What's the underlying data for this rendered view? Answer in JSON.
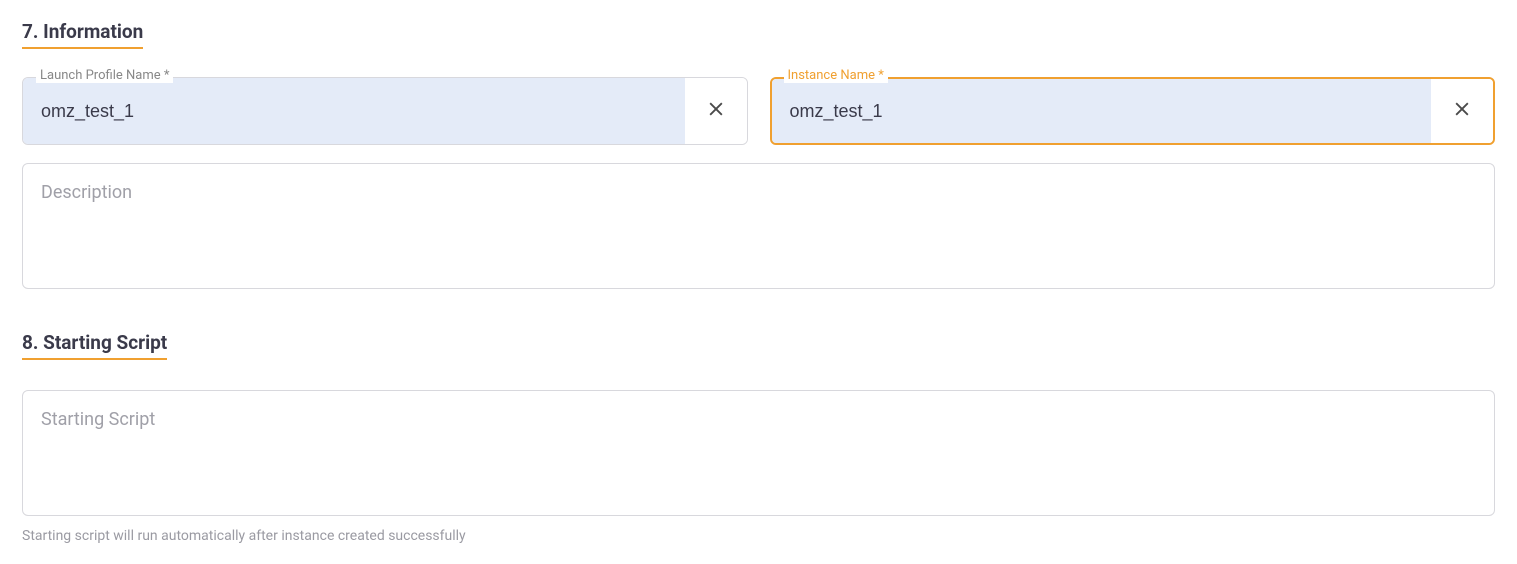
{
  "sections": {
    "information": {
      "title": "7. Information",
      "launchProfile": {
        "label": "Launch Profile Name *",
        "value": "omz_test_1"
      },
      "instanceName": {
        "label": "Instance Name *",
        "value": "omz_test_1"
      },
      "description": {
        "placeholder": "Description",
        "value": ""
      }
    },
    "startingScript": {
      "title": "8. Starting Script",
      "script": {
        "placeholder": "Starting Script",
        "value": ""
      },
      "helper": "Starting script will run automatically after instance created successfully"
    }
  }
}
